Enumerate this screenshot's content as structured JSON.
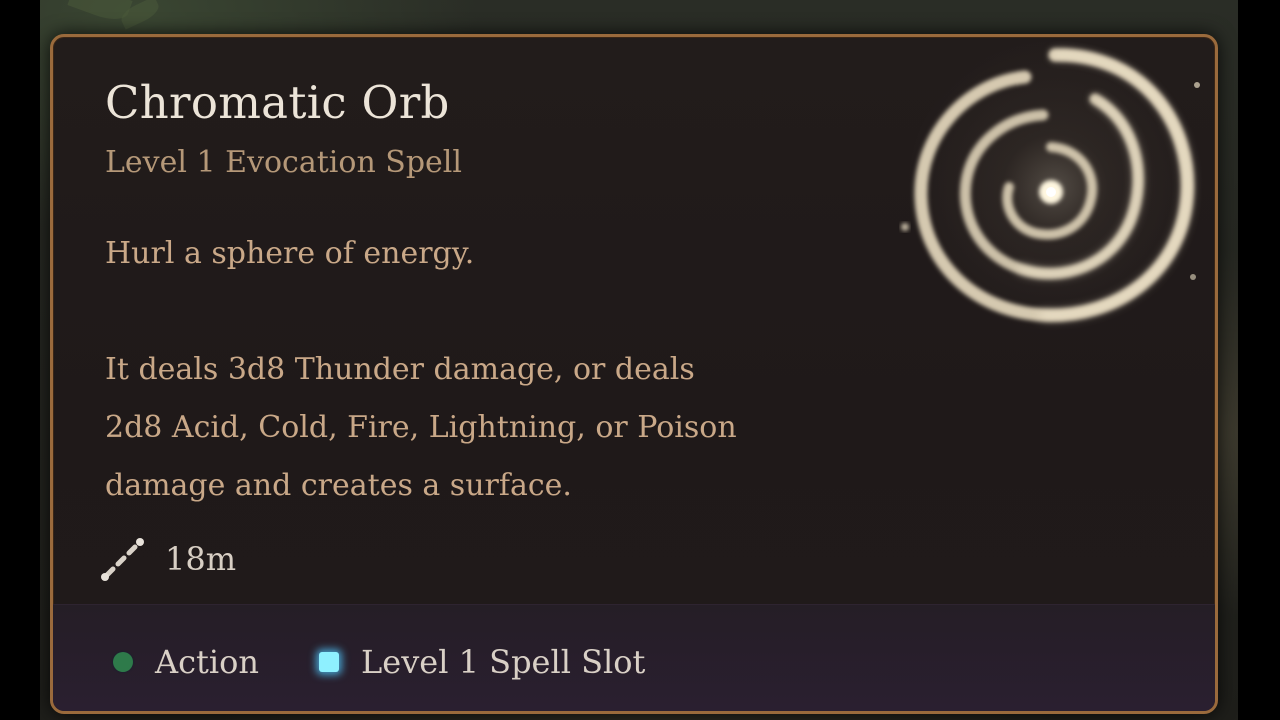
{
  "tooltip": {
    "title": "Chromatic Orb",
    "subtitle": "Level 1 Evocation Spell",
    "description_intro": "Hurl a sphere of energy.",
    "description_lines": [
      "It deals 3d8 Thunder damage, or deals",
      "2d8 Acid, Cold, Fire, Lightning, or Poison",
      "damage and creates a surface."
    ],
    "range": {
      "icon": "range-icon",
      "value": "18m"
    },
    "costs": {
      "action": {
        "icon": "action-dot-icon",
        "label": "Action",
        "color": "#2e7a4a"
      },
      "spell_slot": {
        "icon": "spell-slot-icon",
        "label": "Level 1 Spell Slot",
        "color": "#8ef0ff"
      }
    },
    "border_color": "#9a6a3c",
    "art_icon": "chromatic-orb-spell-icon"
  }
}
